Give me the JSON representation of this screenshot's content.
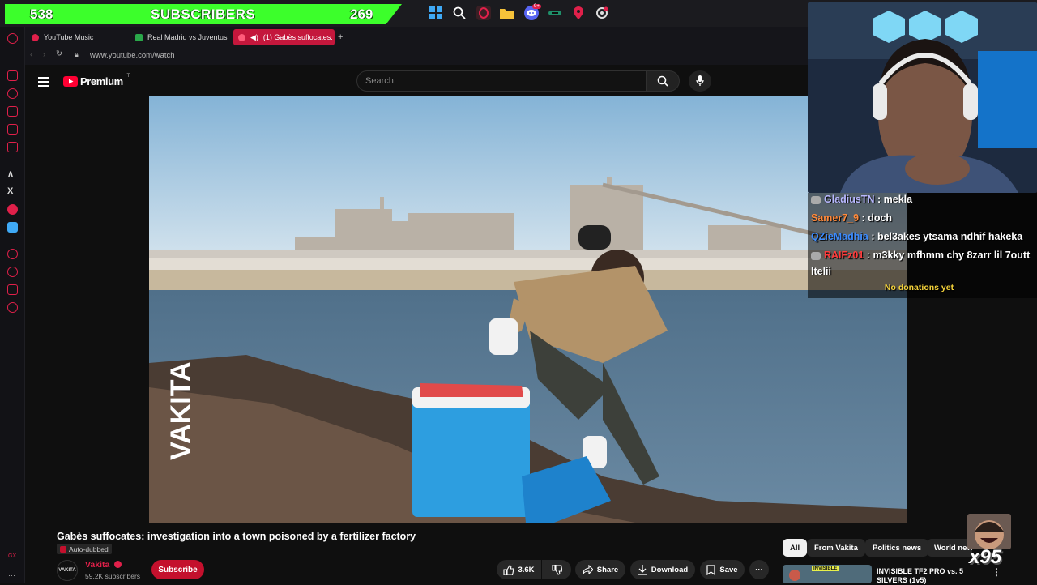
{
  "overlay": {
    "sub_left": "538",
    "sub_label": "SUBSCRIBERS",
    "sub_right": "269",
    "combo": "x95"
  },
  "taskbar": {
    "icons": [
      "windows-icon",
      "search-icon",
      "opera-icon",
      "folder-icon",
      "discord-icon",
      "app-icon",
      "maps-icon",
      "settings-icon"
    ],
    "discord_badge": "9+"
  },
  "browser": {
    "tabs": [
      {
        "label": "YouTube Music"
      },
      {
        "label": "Real Madrid vs Juventus"
      },
      {
        "label": "(1) Gabès suffocates:"
      }
    ],
    "url": "www.youtube.com/watch"
  },
  "youtube": {
    "logo_text": "Premium",
    "logo_sup": "IT",
    "search_placeholder": "Search",
    "video_watermark": "VAKITA",
    "title": "Gabès suffocates: investigation into a town poisoned by a fertilizer factory",
    "dub_label": "Auto-dubbed",
    "channel": {
      "name": "Vakita",
      "subs": "59.2K subscribers",
      "avatar_text": "VAKITA"
    },
    "subscribe_label": "Subscribe",
    "likes": "3.6K",
    "share_label": "Share",
    "download_label": "Download",
    "save_label": "Save",
    "chips": [
      "All",
      "From Vakita",
      "Politics news",
      "World news"
    ],
    "rec": {
      "thumb_text": "INVISIBLE",
      "title": "INVISIBLE TF2 PRO vs. 5 SILVERS (1v5)"
    }
  },
  "chat": {
    "messages": [
      {
        "user": "GladiusTN",
        "text": "mekla",
        "color": "#b8b8ff"
      },
      {
        "user": "Samer7_9",
        "text": "doch",
        "color": "#ff8a3c"
      },
      {
        "user": "QZieMadhia",
        "text": "bel3akes ytsama ndhif hakeka",
        "color": "#3c8cff"
      },
      {
        "user": "RAIFz01",
        "text": "m3kky mfhmm chy 8zarr lil 7outt",
        "color": "#ff3c3c"
      }
    ],
    "overflow_line": "ltelii",
    "donations": "No donations yet"
  },
  "colors": {
    "accent": "#c4173c",
    "sub_green": "#3cff2b",
    "donation_yellow": "#f5d33a"
  }
}
